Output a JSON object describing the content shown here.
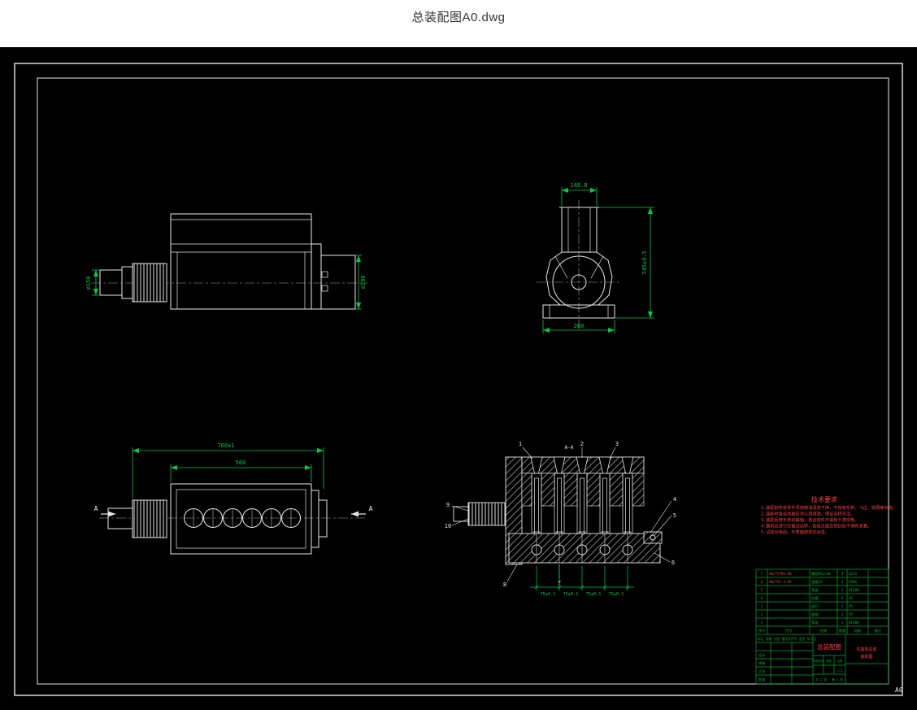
{
  "header": {
    "title": "总装配图A0.dwg"
  },
  "frame": {
    "size_label": "A0"
  },
  "views": {
    "side": {
      "dim_shaft": "⌀150",
      "dim_pulley": "⌀200"
    },
    "front": {
      "dim_width": "148.8",
      "dim_height": "745±0.5",
      "dim_base": "260"
    },
    "top": {
      "dim_overall": "760±1",
      "dim_body": "560",
      "section_a_left": "A",
      "section_a_right": "A"
    },
    "section": {
      "label": "A-A",
      "dims": [
        "75±0.1",
        "75±0.1",
        "75±0.1",
        "75±0.1"
      ],
      "callouts": [
        "1",
        "2",
        "3",
        "4",
        "5",
        "6",
        "7",
        "8",
        "9",
        "10"
      ]
    }
  },
  "notes": {
    "title": "技术要求",
    "lines": [
      "1.装配前所有零件须用煤油清洗干净，不得有毛刺、飞边、铁屑等杂物。",
      "2.装配时各运动副应涂以润滑油，保证运转灵活。",
      "3.装配后用手转动曲轴，各运动件不得有卡滞现象。",
      "4.整机应进行空载试运转，各结合面及密封处不得有渗漏。",
      "5.试验合格后，外表面按规定涂漆。"
    ]
  },
  "title_block": {
    "bom_header": [
      "序号",
      "代号",
      "名称",
      "数量",
      "材料",
      "备注"
    ],
    "bom_rows": [
      [
        "7",
        "GB/T5782-86",
        "螺栓M12×40",
        "4",
        "Q235"
      ],
      [
        "6",
        "GB/T97.1-85",
        "垫圈12",
        "4",
        "65Mn"
      ],
      [
        "5",
        "",
        "泵盖",
        "1",
        "HT200"
      ],
      [
        "4",
        "",
        "柱塞",
        "5",
        "45"
      ],
      [
        "3",
        "",
        "连杆",
        "5",
        "45"
      ],
      [
        "2",
        "",
        "曲轴",
        "1",
        "45"
      ],
      [
        "1",
        "",
        "泵体",
        "1",
        "HT200"
      ]
    ],
    "change_row": "标记 处数 分区 更改文件号 签名 年月日",
    "sign_rows": [
      "设计",
      "审核",
      "工艺",
      "批准"
    ],
    "drawing_title": "总装配图",
    "org_line1": "柱塞泵总成",
    "org_line2": "装配图",
    "fields": {
      "stage": "阶段标记",
      "weight": "质量",
      "scale": "比例",
      "scale_value": "1:2",
      "sheets": "共 1 张",
      "sheet_no": "第 1 张"
    }
  }
}
